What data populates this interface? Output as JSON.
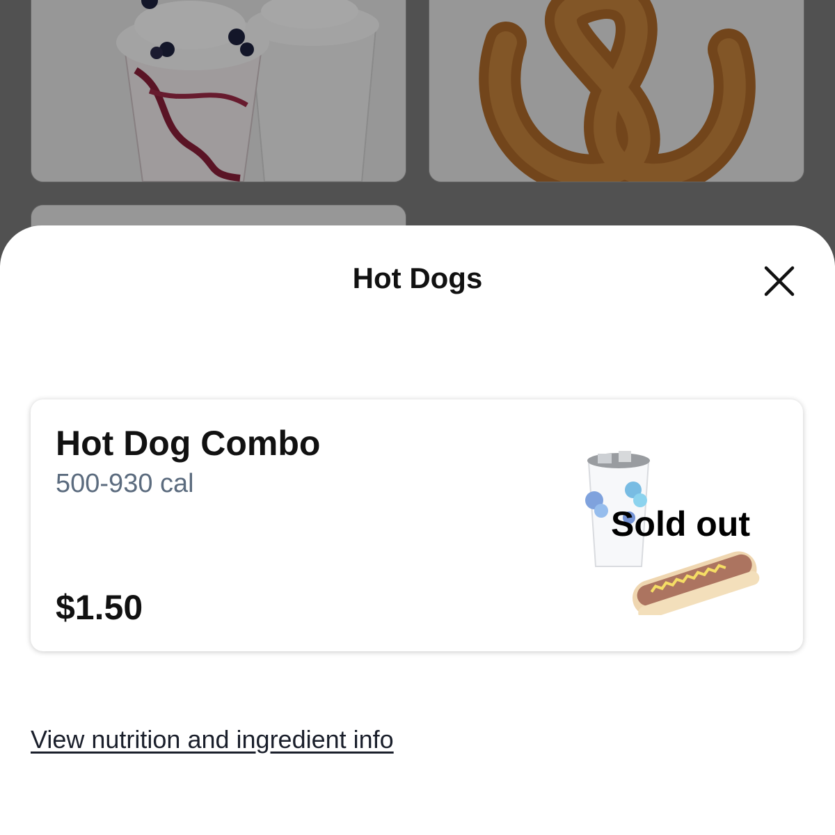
{
  "sheet": {
    "title": "Hot Dogs",
    "close_icon": "close-icon"
  },
  "item": {
    "name": "Hot Dog Combo",
    "calories": "500-930 cal",
    "price": "$1.50",
    "status": "Sold out",
    "image_icon": "drink-and-hot-dog-image"
  },
  "nutrition_link": "View nutrition and ingredient info",
  "background_items": [
    {
      "image": "milkshake-image"
    },
    {
      "image": "pretzel-image"
    },
    {
      "image": "menu-item-image"
    }
  ],
  "colors": {
    "scrim": "#7d7d7d",
    "text": "#111111",
    "calories": "#5b6b7e"
  }
}
